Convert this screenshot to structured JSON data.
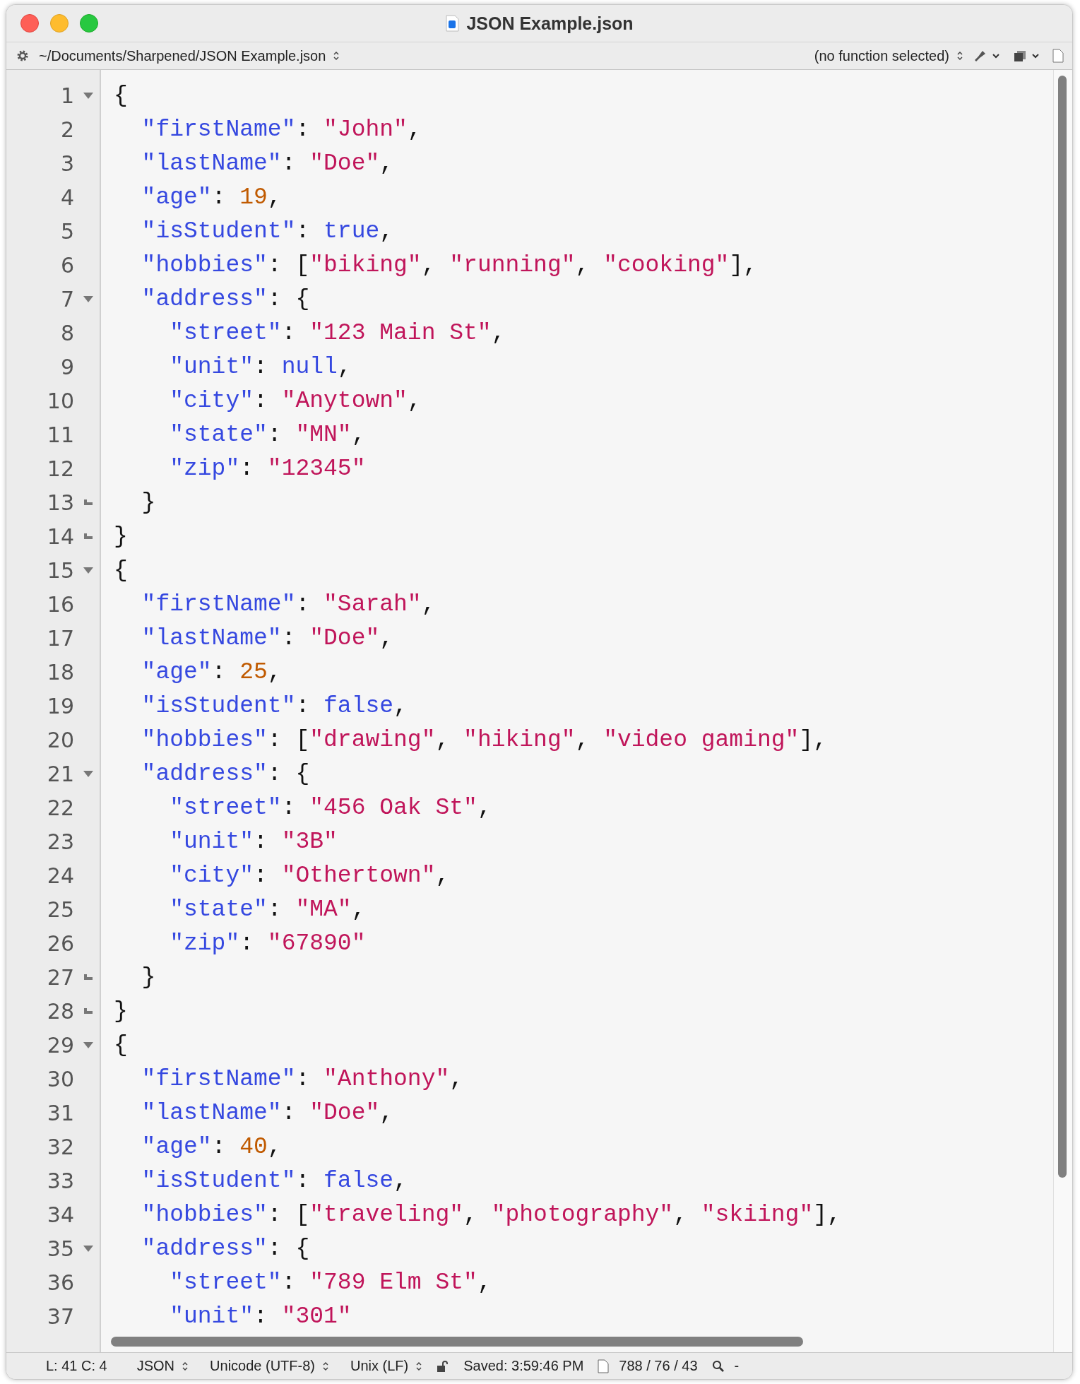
{
  "window": {
    "title": "JSON Example.json"
  },
  "toolbar": {
    "path": "~/Documents/Sharpened/JSON Example.json",
    "function_menu": "(no function selected)"
  },
  "lines": [
    {
      "number": "1",
      "kind": "fold-start",
      "tokens": [
        {
          "kind": "punct",
          "text": "{"
        }
      ],
      "children": [
        {
          "number": "2",
          "tokens": [
            {
              "kind": "key",
              "text": "\"firstName\""
            },
            {
              "kind": "punct",
              "text": ": "
            },
            {
              "kind": "string",
              "text": "\"John\""
            },
            {
              "kind": "punct",
              "text": ","
            }
          ]
        },
        {
          "number": "3",
          "tokens": [
            {
              "kind": "key",
              "text": "\"lastName\""
            },
            {
              "kind": "punct",
              "text": ": "
            },
            {
              "kind": "string",
              "text": "\"Doe\""
            },
            {
              "kind": "punct",
              "text": ","
            }
          ]
        },
        {
          "number": "4",
          "tokens": [
            {
              "kind": "key",
              "text": "\"age\""
            },
            {
              "kind": "punct",
              "text": ": "
            },
            {
              "kind": "number",
              "text": "19"
            },
            {
              "kind": "punct",
              "text": ","
            }
          ]
        },
        {
          "number": "5",
          "tokens": [
            {
              "kind": "key",
              "text": "\"isStudent\""
            },
            {
              "kind": "punct",
              "text": ": "
            },
            {
              "kind": "keyword",
              "text": "true"
            },
            {
              "kind": "punct",
              "text": ","
            }
          ]
        },
        {
          "number": "6",
          "tokens": [
            {
              "kind": "key",
              "text": "\"hobbies\""
            },
            {
              "kind": "punct",
              "text": ": ["
            },
            {
              "kind": "string",
              "text": "\"biking\""
            },
            {
              "kind": "punct",
              "text": ", "
            },
            {
              "kind": "string",
              "text": "\"running\""
            },
            {
              "kind": "punct",
              "text": ", "
            },
            {
              "kind": "string",
              "text": "\"cooking\""
            },
            {
              "kind": "punct",
              "text": "],"
            }
          ]
        },
        {
          "number": "7",
          "kind": "fold-start",
          "tokens": [
            {
              "kind": "key",
              "text": "\"address\""
            },
            {
              "kind": "punct",
              "text": ": {"
            }
          ],
          "children": [
            {
              "number": "8",
              "tokens": [
                {
                  "kind": "key",
                  "text": "\"street\""
                },
                {
                  "kind": "punct",
                  "text": ": "
                },
                {
                  "kind": "string",
                  "text": "\"123 Main St\""
                },
                {
                  "kind": "punct",
                  "text": ","
                }
              ]
            },
            {
              "number": "9",
              "tokens": [
                {
                  "kind": "key",
                  "text": "\"unit\""
                },
                {
                  "kind": "punct",
                  "text": ": "
                },
                {
                  "kind": "keyword",
                  "text": "null"
                },
                {
                  "kind": "punct",
                  "text": ","
                }
              ]
            },
            {
              "number": "10",
              "tokens": [
                {
                  "kind": "key",
                  "text": "\"city\""
                },
                {
                  "kind": "punct",
                  "text": ": "
                },
                {
                  "kind": "string",
                  "text": "\"Anytown\""
                },
                {
                  "kind": "punct",
                  "text": ","
                }
              ]
            },
            {
              "number": "11",
              "tokens": [
                {
                  "kind": "key",
                  "text": "\"state\""
                },
                {
                  "kind": "punct",
                  "text": ": "
                },
                {
                  "kind": "string",
                  "text": "\"MN\""
                },
                {
                  "kind": "punct",
                  "text": ","
                }
              ]
            },
            {
              "number": "12",
              "tokens": [
                {
                  "kind": "key",
                  "text": "\"zip\""
                },
                {
                  "kind": "punct",
                  "text": ": "
                },
                {
                  "kind": "string",
                  "text": "\"12345\""
                }
              ]
            }
          ]
        },
        {
          "number": "13",
          "kind": "fold-end",
          "tokens": [
            {
              "kind": "punct",
              "text": "}"
            }
          ]
        }
      ]
    },
    {
      "number": "14",
      "kind": "fold-end",
      "tokens": [
        {
          "kind": "punct",
          "text": "}"
        }
      ]
    },
    {
      "number": "15",
      "kind": "fold-start",
      "tokens": [
        {
          "kind": "punct",
          "text": "{"
        }
      ],
      "children": [
        {
          "number": "16",
          "tokens": [
            {
              "kind": "key",
              "text": "\"firstName\""
            },
            {
              "kind": "punct",
              "text": ": "
            },
            {
              "kind": "string",
              "text": "\"Sarah\""
            },
            {
              "kind": "punct",
              "text": ","
            }
          ]
        },
        {
          "number": "17",
          "tokens": [
            {
              "kind": "key",
              "text": "\"lastName\""
            },
            {
              "kind": "punct",
              "text": ": "
            },
            {
              "kind": "string",
              "text": "\"Doe\""
            },
            {
              "kind": "punct",
              "text": ","
            }
          ]
        },
        {
          "number": "18",
          "tokens": [
            {
              "kind": "key",
              "text": "\"age\""
            },
            {
              "kind": "punct",
              "text": ": "
            },
            {
              "kind": "number",
              "text": "25"
            },
            {
              "kind": "punct",
              "text": ","
            }
          ]
        },
        {
          "number": "19",
          "tokens": [
            {
              "kind": "key",
              "text": "\"isStudent\""
            },
            {
              "kind": "punct",
              "text": ": "
            },
            {
              "kind": "keyword",
              "text": "false"
            },
            {
              "kind": "punct",
              "text": ","
            }
          ]
        },
        {
          "number": "20",
          "tokens": [
            {
              "kind": "key",
              "text": "\"hobbies\""
            },
            {
              "kind": "punct",
              "text": ": ["
            },
            {
              "kind": "string",
              "text": "\"drawing\""
            },
            {
              "kind": "punct",
              "text": ", "
            },
            {
              "kind": "string",
              "text": "\"hiking\""
            },
            {
              "kind": "punct",
              "text": ", "
            },
            {
              "kind": "string",
              "text": "\"video gaming\""
            },
            {
              "kind": "punct",
              "text": "],"
            }
          ]
        },
        {
          "number": "21",
          "kind": "fold-start",
          "tokens": [
            {
              "kind": "key",
              "text": "\"address\""
            },
            {
              "kind": "punct",
              "text": ": {"
            }
          ],
          "children": [
            {
              "number": "22",
              "tokens": [
                {
                  "kind": "key",
                  "text": "\"street\""
                },
                {
                  "kind": "punct",
                  "text": ": "
                },
                {
                  "kind": "string",
                  "text": "\"456 Oak St\""
                },
                {
                  "kind": "punct",
                  "text": ","
                }
              ]
            },
            {
              "number": "23",
              "tokens": [
                {
                  "kind": "key",
                  "text": "\"unit\""
                },
                {
                  "kind": "punct",
                  "text": ": "
                },
                {
                  "kind": "string",
                  "text": "\"3B\""
                }
              ]
            },
            {
              "number": "24",
              "tokens": [
                {
                  "kind": "key",
                  "text": "\"city\""
                },
                {
                  "kind": "punct",
                  "text": ": "
                },
                {
                  "kind": "string",
                  "text": "\"Othertown\""
                },
                {
                  "kind": "punct",
                  "text": ","
                }
              ]
            },
            {
              "number": "25",
              "tokens": [
                {
                  "kind": "key",
                  "text": "\"state\""
                },
                {
                  "kind": "punct",
                  "text": ": "
                },
                {
                  "kind": "string",
                  "text": "\"MA\""
                },
                {
                  "kind": "punct",
                  "text": ","
                }
              ]
            },
            {
              "number": "26",
              "tokens": [
                {
                  "kind": "key",
                  "text": "\"zip\""
                },
                {
                  "kind": "punct",
                  "text": ": "
                },
                {
                  "kind": "string",
                  "text": "\"67890\""
                }
              ]
            }
          ]
        },
        {
          "number": "27",
          "kind": "fold-end",
          "tokens": [
            {
              "kind": "punct",
              "text": "}"
            }
          ]
        }
      ]
    },
    {
      "number": "28",
      "kind": "fold-end",
      "tokens": [
        {
          "kind": "punct",
          "text": "}"
        }
      ]
    },
    {
      "number": "29",
      "kind": "fold-start",
      "tokens": [
        {
          "kind": "punct",
          "text": "{"
        }
      ],
      "children": [
        {
          "number": "30",
          "tokens": [
            {
              "kind": "key",
              "text": "\"firstName\""
            },
            {
              "kind": "punct",
              "text": ": "
            },
            {
              "kind": "string",
              "text": "\"Anthony\""
            },
            {
              "kind": "punct",
              "text": ","
            }
          ]
        },
        {
          "number": "31",
          "tokens": [
            {
              "kind": "key",
              "text": "\"lastName\""
            },
            {
              "kind": "punct",
              "text": ": "
            },
            {
              "kind": "string",
              "text": "\"Doe\""
            },
            {
              "kind": "punct",
              "text": ","
            }
          ]
        },
        {
          "number": "32",
          "tokens": [
            {
              "kind": "key",
              "text": "\"age\""
            },
            {
              "kind": "punct",
              "text": ": "
            },
            {
              "kind": "number",
              "text": "40"
            },
            {
              "kind": "punct",
              "text": ","
            }
          ]
        },
        {
          "number": "33",
          "tokens": [
            {
              "kind": "key",
              "text": "\"isStudent\""
            },
            {
              "kind": "punct",
              "text": ": "
            },
            {
              "kind": "keyword",
              "text": "false"
            },
            {
              "kind": "punct",
              "text": ","
            }
          ]
        },
        {
          "number": "34",
          "tokens": [
            {
              "kind": "key",
              "text": "\"hobbies\""
            },
            {
              "kind": "punct",
              "text": ": ["
            },
            {
              "kind": "string",
              "text": "\"traveling\""
            },
            {
              "kind": "punct",
              "text": ", "
            },
            {
              "kind": "string",
              "text": "\"photography\""
            },
            {
              "kind": "punct",
              "text": ", "
            },
            {
              "kind": "string",
              "text": "\"skiing\""
            },
            {
              "kind": "punct",
              "text": "],"
            }
          ]
        },
        {
          "number": "35",
          "kind": "fold-start",
          "tokens": [
            {
              "kind": "key",
              "text": "\"address\""
            },
            {
              "kind": "punct",
              "text": ": {"
            }
          ],
          "children": [
            {
              "number": "36",
              "tokens": [
                {
                  "kind": "key",
                  "text": "\"street\""
                },
                {
                  "kind": "punct",
                  "text": ": "
                },
                {
                  "kind": "string",
                  "text": "\"789 Elm St\""
                },
                {
                  "kind": "punct",
                  "text": ","
                }
              ]
            },
            {
              "number": "37",
              "tokens": [
                {
                  "kind": "key",
                  "text": "\"unit\""
                },
                {
                  "kind": "punct",
                  "text": ": "
                },
                {
                  "kind": "string",
                  "text": "\"301\""
                }
              ]
            }
          ]
        }
      ]
    }
  ],
  "status_bar": {
    "position": "L: 41 C: 4",
    "language": "JSON",
    "encoding": "Unicode (UTF-8)",
    "line_endings": "Unix (LF)",
    "saved": "Saved: 3:59:46 PM",
    "counts": "788 / 76 / 43",
    "search": "-"
  }
}
